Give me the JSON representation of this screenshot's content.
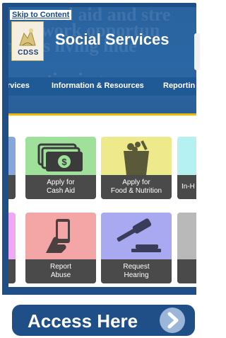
{
  "header": {
    "skip_link": "Skip to Content",
    "logo_text": "CDSS",
    "title": "Social Services",
    "watermark_lines": [
      "and aid and stre",
      "work opportun",
      "milies living inde",
      "s continuing care"
    ]
  },
  "nav": {
    "items": [
      "rvices",
      "Information & Resources",
      "Reportin"
    ]
  },
  "tiles": [
    {
      "line1": "",
      "line2": "",
      "color": "#86a6dc",
      "icon": "partial-tile"
    },
    {
      "line1": "Apply for",
      "line2": "Cash Aid",
      "color": "#9fe09a",
      "icon": "cash-icon"
    },
    {
      "line1": "Apply for",
      "line2": "Food & Nutrition",
      "color": "#eee98a",
      "icon": "grocery-bag-icon"
    },
    {
      "line1": "In-H",
      "line2": "",
      "color": "#b5f1f0",
      "icon": "partial-tile"
    },
    {
      "line1": "",
      "line2": "",
      "color": "#f0a7f5",
      "icon": "partial-tile"
    },
    {
      "line1": "Report",
      "line2": "Abuse",
      "color": "#f4a5a5",
      "icon": "phone-in-hand-icon"
    },
    {
      "line1": "Request",
      "line2": "Hearing",
      "color": "#a8a9f0",
      "icon": "gavel-icon"
    },
    {
      "line1": "",
      "line2": "",
      "color": "#b9b9b9",
      "icon": "partial-tile"
    }
  ],
  "access_button": {
    "label": "Access Here",
    "icon": "chevron-right-icon"
  },
  "colors": {
    "brand_blue": "#1f4f86",
    "header_blue": "#2b67a5",
    "accent_gold": "#f2b600",
    "tile_label_bg": "#4a4a4a"
  }
}
